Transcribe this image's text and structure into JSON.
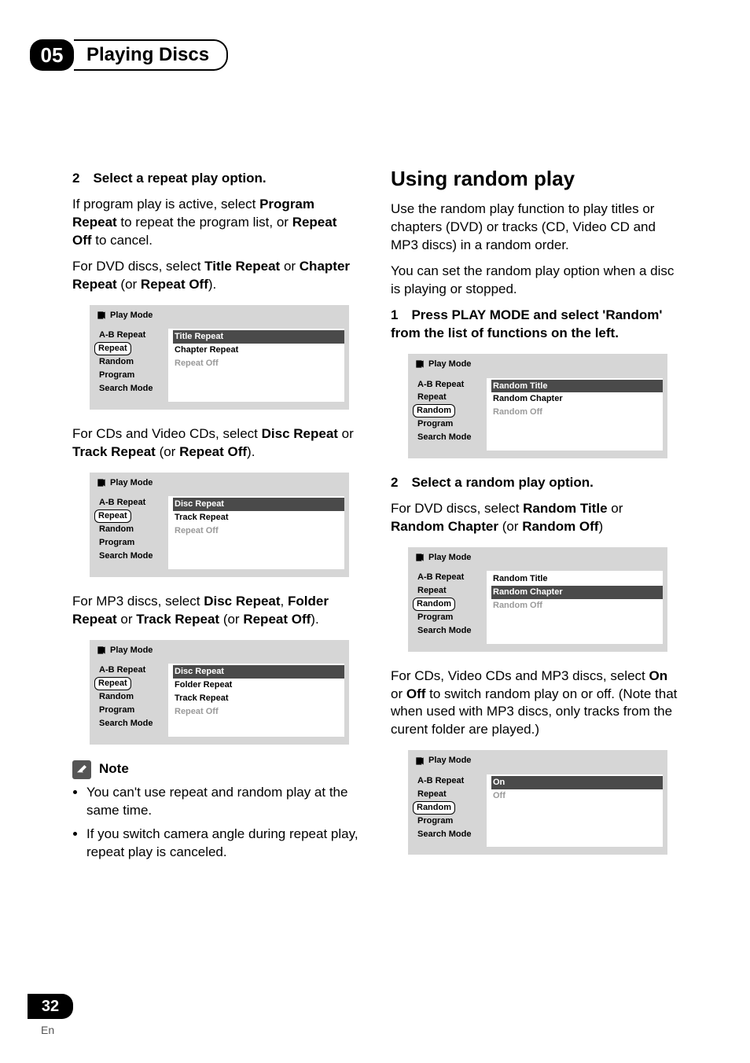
{
  "chapter": {
    "num": "05",
    "title": "Playing Discs"
  },
  "page": {
    "num": "32",
    "lang": "En"
  },
  "left": {
    "step2": "2 Select a repeat play option.",
    "p1a": "If program play is active, select ",
    "p1b": "Program Repeat",
    "p1c": " to repeat the program list, or ",
    "p1d": "Repeat Off",
    "p1e": " to cancel.",
    "p2a": "For DVD discs, select ",
    "p2b": "Title Repeat",
    "p2c": " or ",
    "p2d": "Chapter Repeat",
    "p2e": " (or ",
    "p2f": "Repeat Off",
    "p2g": ").",
    "p3a": "For CDs and Video CDs, select ",
    "p3b": "Disc Repeat",
    "p3c": " or ",
    "p3d": "Track Repeat",
    "p3e": " (or ",
    "p3f": "Repeat Off",
    "p3g": ").",
    "p4a": "For MP3 discs, select ",
    "p4b": "Disc Repeat",
    "p4c": ", ",
    "p4d": "Folder Repeat",
    "p4e": " or ",
    "p4f": "Track Repeat",
    "p4g": " (or ",
    "p4h": "Repeat Off",
    "p4i": ").",
    "note_label": "Note",
    "note1": "You can't use repeat and random play at the same time.",
    "note2": "If you switch camera angle during repeat play, repeat play is canceled."
  },
  "right": {
    "h2": "Using random play",
    "p1": "Use the random play function to play titles or chapters (DVD) or tracks (CD, Video CD and MP3 discs) in a random order.",
    "p2": "You can set the random play option when a disc is playing or stopped.",
    "step1": "1 Press PLAY MODE and select 'Random' from the list of functions on the left.",
    "step2": "2 Select a random play option.",
    "p3a": "For DVD discs, select ",
    "p3b": "Random Title",
    "p3c": " or ",
    "p3d": "Random Chapter",
    "p3e": " (or ",
    "p3f": "Random Off",
    "p3g": ")",
    "p4a": "For CDs, Video CDs and MP3 discs, select ",
    "p4b": "On",
    "p4c": " or ",
    "p4d": "Off",
    "p4e": " to switch random play on or off. (Note that when used with MP3 discs, only tracks from the curent folder are played.)"
  },
  "pm": {
    "title": "Play Mode",
    "menu": [
      "A-B Repeat",
      "Repeat",
      "Random",
      "Program",
      "Search Mode"
    ],
    "panels": {
      "repeat_dvd": {
        "sel": 1,
        "opts": [
          {
            "t": "Title Repeat",
            "hl": true
          },
          {
            "t": "Chapter Repeat"
          },
          {
            "t": "Repeat Off",
            "muted": true
          }
        ]
      },
      "repeat_cd": {
        "sel": 1,
        "opts": [
          {
            "t": "Disc Repeat",
            "hl": true
          },
          {
            "t": "Track Repeat"
          },
          {
            "t": "Repeat Off",
            "muted": true
          }
        ]
      },
      "repeat_mp3": {
        "sel": 1,
        "opts": [
          {
            "t": "Disc Repeat",
            "hl": true
          },
          {
            "t": "Folder Repeat"
          },
          {
            "t": "Track Repeat"
          },
          {
            "t": "Repeat Off",
            "muted": true
          }
        ]
      },
      "random_dvd1": {
        "sel": 2,
        "opts": [
          {
            "t": "Random Title",
            "hl": true
          },
          {
            "t": "Random Chapter"
          },
          {
            "t": "Random Off",
            "muted": true
          }
        ]
      },
      "random_dvd2": {
        "sel": 2,
        "opts": [
          {
            "t": "Random Title"
          },
          {
            "t": "Random Chapter",
            "hl": true
          },
          {
            "t": "Random Off",
            "muted": true
          }
        ]
      },
      "random_cd": {
        "sel": 2,
        "opts": [
          {
            "t": "On",
            "hl": true
          },
          {
            "t": "Off",
            "muted": true
          }
        ]
      }
    }
  }
}
